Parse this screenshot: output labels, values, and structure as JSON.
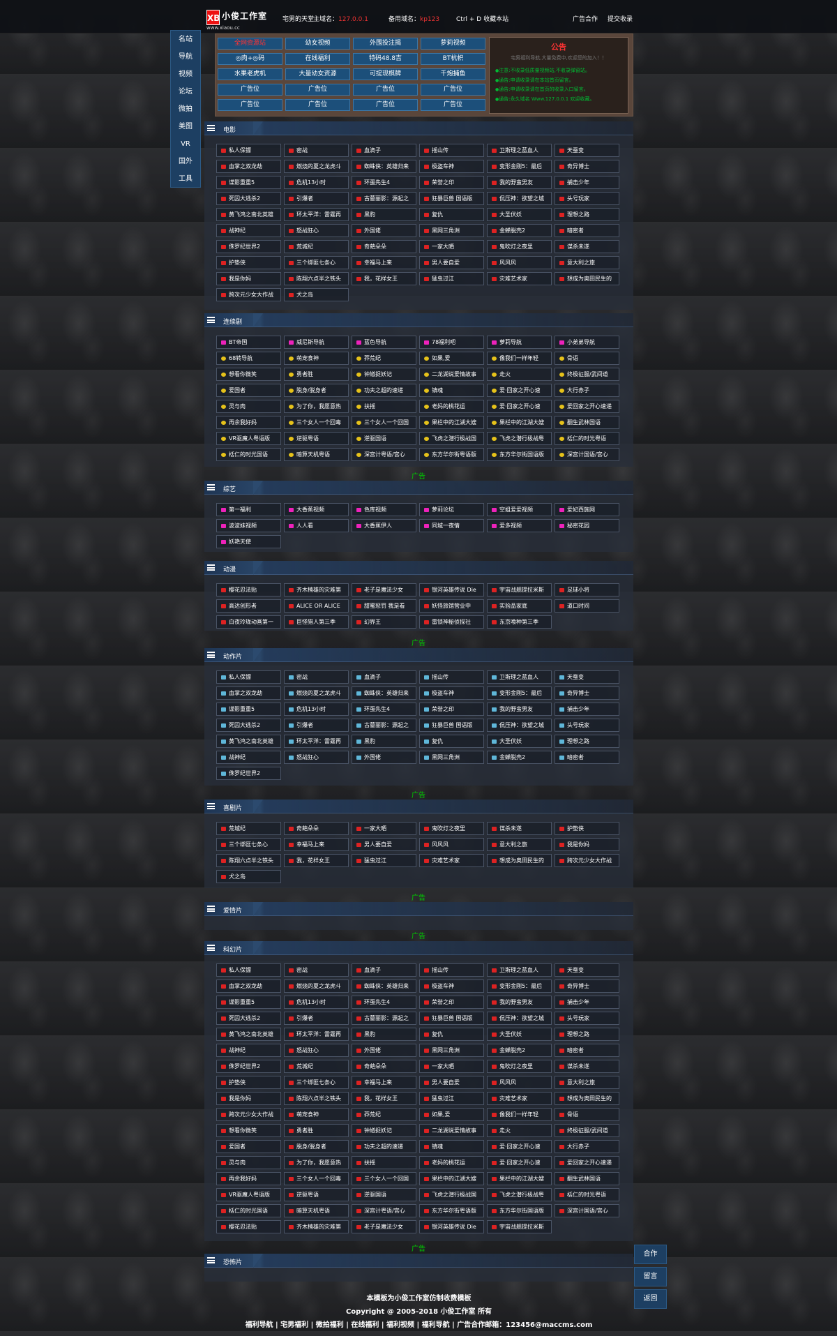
{
  "top": {
    "logo_mark": "XB",
    "logo_title": "小俊工作室",
    "logo_sub": "www.xiaou.cc",
    "tagline": "宅男的天堂",
    "main_domain_label": "主域名：",
    "main_domain": "127.0.0.1",
    "backup_domain_label": "备用域名：",
    "backup_domain": "kp123",
    "bookmark": "Ctrl + D 收藏本站",
    "ad_coop": "广告合作",
    "submit": "提交收录"
  },
  "nav": [
    "名站",
    "导航",
    "视频",
    "论坛",
    "微拍",
    "美图",
    "VR",
    "国外",
    "工具"
  ],
  "quick": [
    [
      "全网资源站",
      "幼女视频",
      "外围投注揭",
      "萝莉视频"
    ],
    [
      "◎肉+◎码",
      "在线福利",
      "特码48.8吉",
      "BT杭帜"
    ],
    [
      "水果老虎机",
      "大量幼女资源",
      "可提现棋牌",
      "千炮捕鱼"
    ],
    [
      "广告位",
      "广告位",
      "广告位",
      "广告位"
    ],
    [
      "广告位",
      "广告位",
      "广告位",
      "广告位"
    ]
  ],
  "notice": {
    "title": "公告",
    "sub": "宅男福利导航,大量免费中,欢迎您的加入！！",
    "items": [
      "注意:不收录低质量视频站,不收录弹窗站。",
      "通告:申请收录请在本站首页留言。",
      "通告:申请收录请在首页的收录入口留言。",
      "通告:永久域名 Www.127.0.0.1 欢迎收藏。"
    ]
  },
  "movies_a": [
    "私人保镖",
    "密战",
    "血滴子",
    "摇山传",
    "卫斯理之蓝血人",
    "天蚕变",
    "血掌之双龙劫",
    "燃烧的夏之龙虎斗",
    "蜘蛛侠：英雄归来",
    "极盗车神",
    "变形金刚5：最后",
    "奇异博士",
    "谍影重重5",
    "危机13小时",
    "环蛋先生4",
    "荣誉之印",
    "我的野蛮男友",
    "捕击少年",
    "死囚大逃杀2",
    "引爆者",
    "古墓丽影：源起之",
    "狂暴巨兽 国语版",
    "侃压神：欲望之城",
    "头号玩家",
    "黄飞鸿之南北英雄",
    "环太平洋：雷霆再",
    "黑豹",
    "复仇",
    "大圣伏妖",
    "理想之路",
    "战神纪",
    "怒战狂心",
    "外国佬",
    "黑网三角洲",
    "金蝉脱壳2",
    "暗密者",
    "侏罗纪世界2",
    "荒城纪",
    "奇葩朵朵",
    "一家大晒",
    "鬼吹灯之夜里",
    "谋杀未遂",
    "护垫侠",
    "三个绑匪七条心",
    "幸福马上来",
    "男人要自爱",
    "风风风",
    "意大利之旅",
    "我是你妈",
    "陈翔六点半之铁头",
    "我，花样女王",
    "猛虫过江",
    "灾难艺术家",
    "想成为奥田民生的",
    "跨次元少女大作战",
    "犬之岛"
  ],
  "series": [
    "BT帝国",
    "威尼斯导航",
    "蓝色导航",
    "78福利吧",
    "萝莉导航",
    "小弟弟导航",
    "68转导航",
    "萌宠食神",
    "莽荒纪",
    "如果,爱",
    "像我们一样年轻",
    "骨语",
    "想看你微笑",
    "勇者胜",
    "钟馗捉妖记",
    "二龙湖说爱情故事",
    "走火",
    "终极征服/武间道",
    "爱国者",
    "脱身/脱身者",
    "功夫之超的速递",
    "镇魂",
    "爱·回家之开心速",
    "大行赤子",
    "灵与肉",
    "为了你，我愿意热",
    "扶摇",
    "老妈的桃花运",
    "爱·回家之开心速",
    "爱回家之开心速递",
    "再余我好妈",
    "三个女人一个回毒",
    "三个女人一个回国",
    "果栏中的江湖大嫂",
    "果栏中的江湖大嫂",
    "翻生武林国语",
    "VR驱魔人粤语版",
    "逆驱粤语",
    "逆驱国语",
    "飞虎之潜行极战国",
    "飞虎之潜行极战粤",
    "栝仁的时光粤语",
    "栝仁的时光国语",
    "暗算天机粤语",
    "深宫计粤语/宫心",
    "东方华尔街粤语版",
    "东方华尔街国语版",
    "深宫计国语/宫心"
  ],
  "variety": [
    "第一福利",
    "大香蕉视频",
    "色库视频",
    "萝莉论坛",
    "空姐爱爱视频",
    "爱妃西施网",
    "波波妹视频",
    "人人看",
    "大香蕉伊人",
    "同城一夜情",
    "爱多视频",
    "秘密花园",
    "妖艳天使"
  ],
  "anime": [
    "樱花忍法贴",
    "齐木楠雄的灾难第",
    "老子是魔法少女",
    "银河英雄传说 Die",
    "宇宙战舰提拉米斯",
    "足球小将",
    "高达创形者",
    "ALICE OR ALICE",
    "甜蜜惩罚 我是看",
    "妖怪旅馆营业中",
    "实验品家庭",
    "道口时间",
    "白夜玲珑动画第一",
    "巨怪猎人第三季",
    "幻界王",
    "雷锁神秘侦探社",
    "东京喰种第三季"
  ],
  "action": [
    "私人保镖",
    "密战",
    "血滴子",
    "摇山传",
    "卫斯理之蓝血人",
    "天蚕变",
    "血掌之双龙劫",
    "燃烧的夏之龙虎斗",
    "蜘蛛侠：英雄归来",
    "极盗车神",
    "变形金刚5：最后",
    "奇异博士",
    "谍影重重5",
    "危机13小时",
    "环蛋先生4",
    "荣誉之印",
    "我的野蛮男友",
    "捕击少年",
    "死囚大逃杀2",
    "引爆者",
    "古墓丽影：源起之",
    "狂暴巨兽 国语版",
    "侃压神：欲望之城",
    "头号玩家",
    "黄飞鸿之南北英雄",
    "环太平洋：雷霆再",
    "黑豹",
    "复仇",
    "大圣伏妖",
    "理想之路",
    "战神纪",
    "怒战狂心",
    "外国佬",
    "黑网三角洲",
    "金蝉脱壳2",
    "暗密者",
    "侏罗纪世界2"
  ],
  "comedy": [
    "荒城纪",
    "奇葩朵朵",
    "一家大晒",
    "鬼吹灯之夜里",
    "谋杀未遂",
    "护垫侠",
    "三个绑匪七条心",
    "幸福马上来",
    "男人要自爱",
    "风风风",
    "意大利之旅",
    "我是你妈",
    "陈翔六点半之铁头",
    "我，花样女王",
    "猛虫过江",
    "灾难艺术家",
    "想成为奥田民生的",
    "跨次元少女大作战",
    "犬之岛"
  ],
  "scifi": [
    "私人保镖",
    "密战",
    "血滴子",
    "摇山传",
    "卫斯理之蓝血人",
    "天蚕变",
    "血掌之双龙劫",
    "燃烧的夏之龙虎斗",
    "蜘蛛侠：英雄归来",
    "极盗车神",
    "变形金刚5：最后",
    "奇异博士",
    "谍影重重5",
    "危机13小时",
    "环蛋先生4",
    "荣誉之印",
    "我的野蛮男友",
    "捕击少年",
    "死囚大逃杀2",
    "引爆者",
    "古墓丽影：源起之",
    "狂暴巨兽 国语版",
    "侃压神：欲望之城",
    "头号玩家",
    "黄飞鸿之南北英雄",
    "环太平洋：雷霆再",
    "黑豹",
    "复仇",
    "大圣伏妖",
    "理想之路",
    "战神纪",
    "怒战狂心",
    "外国佬",
    "黑网三角洲",
    "金蝉脱壳2",
    "暗密者",
    "侏罗纪世界2",
    "荒城纪",
    "奇葩朵朵",
    "一家大晒",
    "鬼吹灯之夜里",
    "谋杀未遂",
    "护垫侠",
    "三个绑匪七条心",
    "幸福马上来",
    "男人要自爱",
    "风风风",
    "意大利之旅",
    "我是你妈",
    "陈翔六点半之铁头",
    "我，花样女王",
    "猛虫过江",
    "灾难艺术家",
    "想成为奥田民生的",
    "跨次元少女大作战",
    "萌宠食神",
    "莽荒纪",
    "如果,爱",
    "像我们一样年轻",
    "骨语",
    "想看你微笑",
    "勇者胜",
    "钟馗捉妖记",
    "二龙湖说爱情故事",
    "走火",
    "终极征服/武间道",
    "爱国者",
    "脱身/脱身者",
    "功夫之超的速递",
    "镇魂",
    "爱·回家之开心速",
    "大行赤子",
    "灵与肉",
    "为了你，我愿意热",
    "扶摇",
    "老妈的桃花运",
    "爱·回家之开心速",
    "爱回家之开心速递",
    "再余我好妈",
    "三个女人一个回毒",
    "三个女人一个回国",
    "果栏中的江湖大嫂",
    "果栏中的江湖大嫂",
    "翻生武林国语",
    "VR驱魔人粤语版",
    "逆驱粤语",
    "逆驱国语",
    "飞虎之潜行极战国",
    "飞虎之潜行极战粤",
    "栝仁的时光粤语",
    "栝仁的时光国语",
    "暗算天机粤语",
    "深宫计粤语/宫心",
    "东方华尔街粤语版",
    "东方华尔街国语版",
    "深宫计国语/宫心",
    "樱花忍法贴",
    "齐木楠雄的灾难第",
    "老子是魔法少女",
    "银河英雄传说 Die",
    "宇宙战舰提拉米斯"
  ],
  "sections": {
    "movie": "电影",
    "series": "连续剧",
    "variety": "综艺",
    "anime": "动漫",
    "action": "动作片",
    "comedy": "喜剧片",
    "romance": "爱情片",
    "scifi": "科幻片",
    "horror": "恐怖片"
  },
  "ad": "广告",
  "float": [
    "合作",
    "留言",
    "返回"
  ],
  "footer": {
    "line1": "本模板为小俊工作室仿制收费模板",
    "line2": "Copyright @ 2005-2018 小俊工作室 所有",
    "line3": "福利导航 | 宅男福利 | 微拍福利 | 在线福利 | 福利视频 | 福利导航 | 广告合作邮箱：123456@maccms.com"
  }
}
